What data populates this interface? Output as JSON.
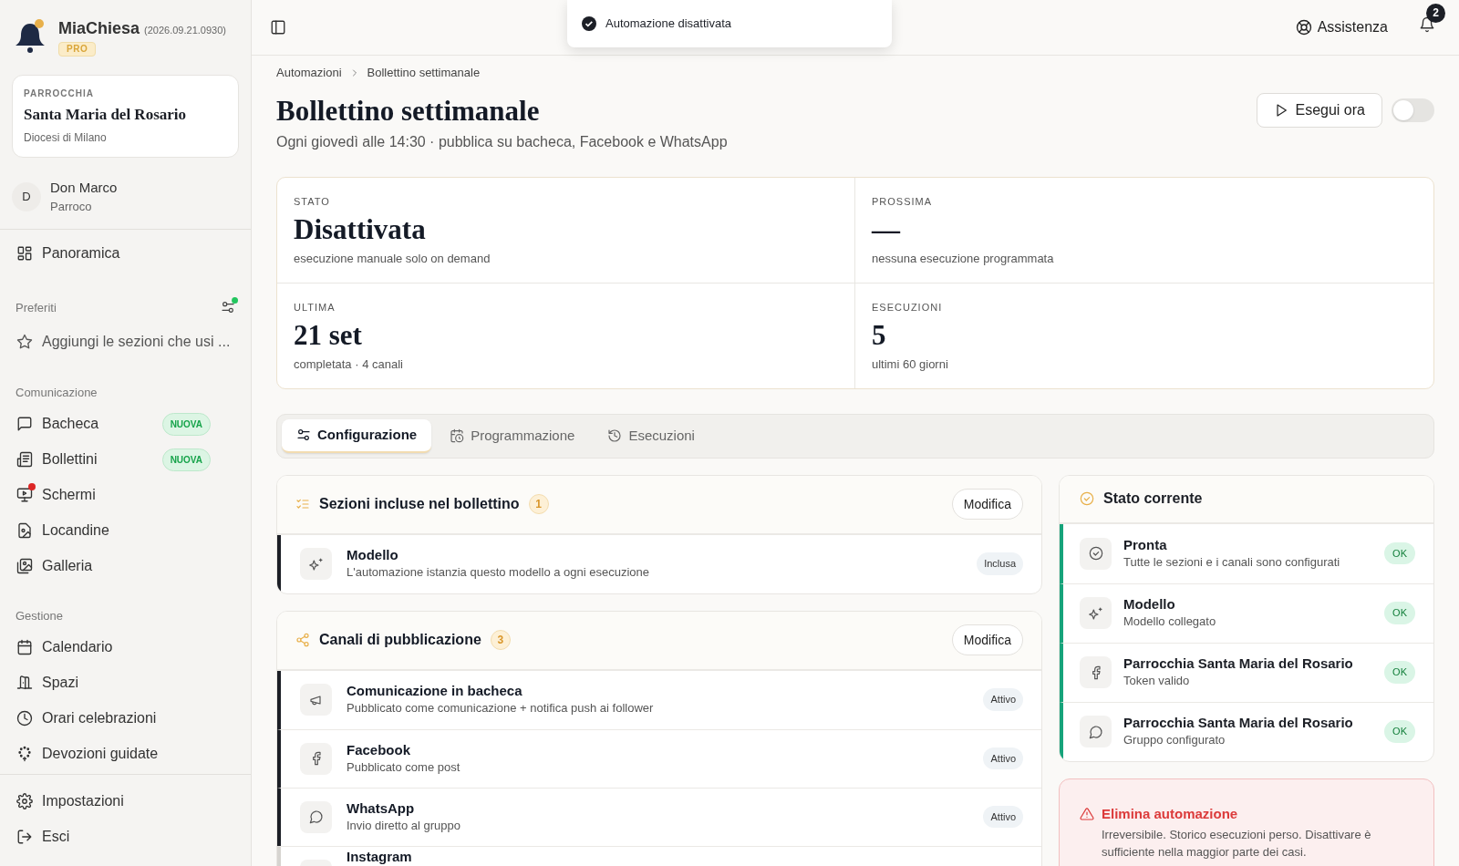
{
  "app": {
    "name": "MiaChiesa",
    "version": "(2026.09.21.0930)",
    "plan": "PRO"
  },
  "parish": {
    "label": "PARROCCHIA",
    "name": "Santa Maria del Rosario",
    "diocese": "Diocesi di Milano"
  },
  "user": {
    "initial": "D",
    "name": "Don Marco",
    "role": "Parroco"
  },
  "overview": {
    "label": "Panoramica"
  },
  "favorites": {
    "title": "Preferiti",
    "placeholder": "Aggiungi le sezioni che usi ..."
  },
  "nav_groups": [
    {
      "title": "Comunicazione",
      "items": [
        {
          "label": "Bacheca",
          "badge": "NUOVA",
          "dot": false
        },
        {
          "label": "Bollettini",
          "badge": "NUOVA",
          "dot": false
        },
        {
          "label": "Schermi",
          "dot": true
        },
        {
          "label": "Locandine",
          "dot": false
        },
        {
          "label": "Galleria",
          "dot": false
        }
      ]
    },
    {
      "title": "Gestione",
      "items": [
        {
          "label": "Calendario",
          "dot": false
        },
        {
          "label": "Spazi",
          "dot": false
        },
        {
          "label": "Orari celebrazioni",
          "dot": false
        },
        {
          "label": "Devozioni guidate",
          "dot": false
        }
      ]
    }
  ],
  "footer_items": [
    "Impostazioni",
    "Esci"
  ],
  "toast": "Automazione disattivata",
  "help": "Assistenza",
  "notifications": "2",
  "breadcrumb": [
    "Automazioni",
    "Bollettino settimanale"
  ],
  "title": "Bollettino settimanale",
  "subtitle": "Ogni giovedì alle 14:30 · pubblica su bacheca, Facebook e WhatsApp",
  "run_button": "Esegui ora",
  "toggle": {
    "on": false
  },
  "stats": [
    {
      "label": "STATO",
      "value": "Disattivata",
      "note": "esecuzione manuale solo on demand"
    },
    {
      "label": "PROSSIMA",
      "value": "—",
      "note": "nessuna esecuzione programmata"
    },
    {
      "label": "ULTIMA",
      "value": "21 set",
      "note": "completata · 4 canali"
    },
    {
      "label": "ESECUZIONI",
      "value": "5",
      "note": "ultimi 60 giorni"
    }
  ],
  "tabs": [
    {
      "label": "Configurazione",
      "selected": true
    },
    {
      "label": "Programmazione",
      "selected": false
    },
    {
      "label": "Esecuzioni",
      "selected": false
    }
  ],
  "cards": [
    {
      "title": "Sezioni incluse nel bollettino",
      "count": "1",
      "action": "Modifica",
      "rows": [
        {
          "title": "Modello",
          "desc": "L'automazione istanzia questo modello a ogni esecuzione",
          "status": "Inclusa",
          "enabled": true
        }
      ]
    },
    {
      "title": "Canali di pubblicazione",
      "count": "3",
      "action": "Modifica",
      "rows": [
        {
          "title": "Comunicazione in bacheca",
          "desc": "Pubblicato come comunicazione + notifica push ai follower",
          "status": "Attivo",
          "enabled": true
        },
        {
          "title": "Facebook",
          "desc": "Pubblicato come post",
          "status": "Attivo",
          "enabled": true
        },
        {
          "title": "WhatsApp",
          "desc": "Invio diretto al gruppo",
          "status": "Attivo",
          "enabled": true
        },
        {
          "title": "Instagram",
          "enabled": false
        }
      ]
    }
  ],
  "status_panel": {
    "title": "Stato corrente",
    "items": [
      {
        "title": "Pronta",
        "desc": "Tutte le sezioni e i canali sono configurati",
        "status": "OK"
      },
      {
        "title": "Modello",
        "desc": "Modello collegato",
        "status": "OK"
      },
      {
        "title": "Parrocchia Santa Maria del Rosario",
        "desc": "Token valido",
        "status": "OK"
      },
      {
        "title": "Parrocchia Santa Maria del Rosario",
        "desc": "Gruppo configurato",
        "status": "OK"
      }
    ]
  },
  "danger": {
    "title": "Elimina automazione",
    "text": "Irreversibile. Storico esecuzioni perso. Disattivare è sufficiente nella maggior parte dei casi."
  }
}
